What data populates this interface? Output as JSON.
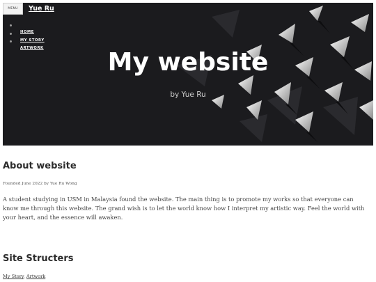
{
  "header": {
    "menu_label": "MENU",
    "site_name": "Yue Ru",
    "nav": [
      {
        "label": "HOME"
      },
      {
        "label": "MY STORY"
      },
      {
        "label": "ARTWORK"
      }
    ]
  },
  "hero": {
    "title": "My website",
    "subtitle": "by Yue Ru"
  },
  "about": {
    "heading": "About website",
    "meta": "Founded June 2022 by Yue Ru Wong",
    "body": "A student studying in USM in Malaysia found the website. The main thing is to promote my works so that everyone can know me through this website. The grand wish is to let the world know how I interpret my artistic way. Feel the world with your heart, and the essence will awaken."
  },
  "structure": {
    "heading": "Site Structers",
    "links": [
      {
        "label": "My Story"
      },
      {
        "label": "Artwork"
      }
    ]
  },
  "colors": {
    "hero_bg": "#1b1b1e",
    "text_dark": "#2b2b2b"
  }
}
